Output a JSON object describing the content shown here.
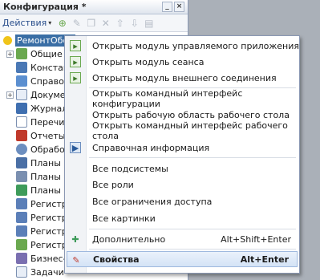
{
  "panel": {
    "title": "Конфигурация *",
    "title_buttons": [
      "_",
      "×"
    ],
    "toolbar": {
      "actions_label": "Действия",
      "caret": "▾"
    }
  },
  "tree": {
    "root": "РемонтОбор",
    "items": [
      {
        "label": "Общие",
        "expander": "+"
      },
      {
        "label": "Констант",
        "expander": ""
      },
      {
        "label": "Справочни",
        "expander": ""
      },
      {
        "label": "Докумен",
        "expander": "+"
      },
      {
        "label": "Журналь",
        "expander": ""
      },
      {
        "label": "Перечис",
        "expander": ""
      },
      {
        "label": "Отчеты",
        "expander": ""
      },
      {
        "label": "Обработ",
        "expander": ""
      },
      {
        "label": "Планы в",
        "expander": ""
      },
      {
        "label": "Планы с",
        "expander": ""
      },
      {
        "label": "Планы в",
        "expander": ""
      },
      {
        "label": "Регистре",
        "expander": ""
      },
      {
        "label": "Регистре",
        "expander": ""
      },
      {
        "label": "Регистре",
        "expander": ""
      },
      {
        "label": "Регистре",
        "expander": ""
      },
      {
        "label": "Бизнес-г",
        "expander": ""
      },
      {
        "label": "Задачи",
        "expander": ""
      }
    ]
  },
  "menu": {
    "items": [
      {
        "label": "Открыть модуль управляемого приложения",
        "key": ""
      },
      {
        "label": "Открыть модуль сеанса",
        "key": ""
      },
      {
        "label": "Открыть модуль внешнего соединения",
        "key": ""
      },
      {
        "label": "Открыть командный интерфейс конфигурации",
        "key": ""
      },
      {
        "label": "Открыть рабочую область рабочего стола",
        "key": ""
      },
      {
        "label": "Открыть командный интерфейс рабочего стола",
        "key": ""
      },
      {
        "label": "Справочная информация",
        "key": ""
      },
      {
        "label": "Все подсистемы",
        "key": ""
      },
      {
        "label": "Все роли",
        "key": ""
      },
      {
        "label": "Все ограничения доступа",
        "key": ""
      },
      {
        "label": "Все картинки",
        "key": ""
      },
      {
        "label": "Дополнительно",
        "key": "Alt+Shift+Enter"
      },
      {
        "label": "Свойства",
        "key": "Alt+Enter"
      }
    ]
  }
}
